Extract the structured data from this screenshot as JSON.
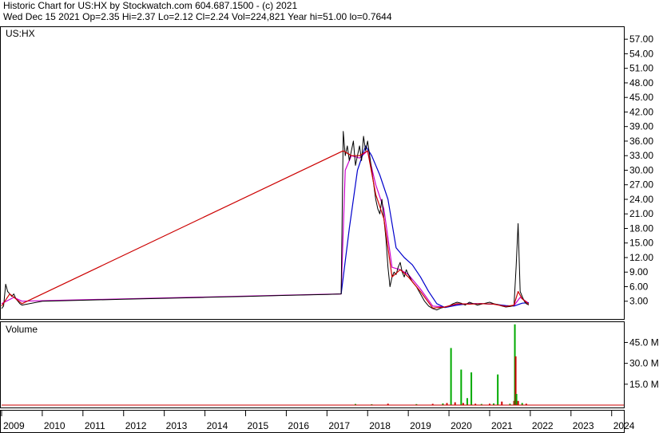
{
  "header": {
    "line1": "Historic Chart for US:HX by Stockwatch.com 604.687.1500 - (c) 2021",
    "line2": "Wed Dec 15 2021  Op=2.35  Hi=2.37  Lo=2.12  Cl=2.24  Vol=224,821  Year hi=51.00  lo=0.7644"
  },
  "colors": {
    "price": "#000000",
    "short_ma": "#cc0000",
    "mid_ma": "#cc00cc",
    "long_ma": "#0000cc",
    "volume_up": "#00aa00",
    "volume_down": "#cc0000"
  },
  "chart_data": [
    {
      "type": "line",
      "title": "US:HX",
      "xlabel": "",
      "ylabel": "",
      "x_tick_labels": [
        "2009",
        "2010",
        "2011",
        "2012",
        "2013",
        "2014",
        "2015",
        "2016",
        "2017",
        "2018",
        "2019",
        "2020",
        "2021",
        "2022",
        "2023",
        "2024"
      ],
      "y_tick_labels": [
        "3.00",
        "6.00",
        "9.00",
        "12.00",
        "15.00",
        "18.00",
        "21.00",
        "24.00",
        "27.00",
        "30.00",
        "33.00",
        "36.00",
        "39.00",
        "42.00",
        "45.00",
        "48.00",
        "51.00",
        "54.00",
        "57.00"
      ],
      "y_ticks": [
        3,
        6,
        9,
        12,
        15,
        18,
        21,
        24,
        27,
        30,
        33,
        36,
        39,
        42,
        45,
        48,
        51,
        54,
        57
      ],
      "ylim": [
        0,
        59
      ],
      "xlim": [
        2009.0,
        2024.3
      ],
      "grid": false,
      "series": [
        {
          "role": "price",
          "x": [
            2009.0,
            2009.05,
            2009.1,
            2009.15,
            2009.2,
            2009.25,
            2009.3,
            2009.35,
            2009.4,
            2009.45,
            2009.5,
            2010.0,
            2011.0,
            2012.0,
            2013.0,
            2014.0,
            2015.0,
            2016.0,
            2017.0,
            2017.35,
            2017.4,
            2017.45,
            2017.5,
            2017.55,
            2017.6,
            2017.65,
            2017.7,
            2017.75,
            2017.8,
            2017.85,
            2017.9,
            2017.95,
            2018.0,
            2018.05,
            2018.1,
            2018.15,
            2018.2,
            2018.25,
            2018.3,
            2018.35,
            2018.4,
            2018.45,
            2018.5,
            2018.55,
            2018.6,
            2018.65,
            2018.7,
            2018.75,
            2018.8,
            2018.85,
            2018.9,
            2018.95,
            2019.0,
            2019.1,
            2019.2,
            2019.3,
            2019.4,
            2019.5,
            2019.6,
            2019.7,
            2019.8,
            2019.9,
            2020.0,
            2020.1,
            2020.2,
            2020.3,
            2020.4,
            2020.5,
            2020.6,
            2020.7,
            2020.8,
            2020.9,
            2021.0,
            2021.1,
            2021.2,
            2021.3,
            2021.4,
            2021.5,
            2021.55,
            2021.6,
            2021.65,
            2021.7,
            2021.75,
            2021.8,
            2021.85,
            2021.9,
            2021.96
          ],
          "values": [
            1.5,
            2.0,
            6.5,
            5.0,
            4.5,
            4.0,
            4.5,
            3.5,
            3.0,
            2.5,
            2.2,
            3.0,
            3.2,
            3.4,
            3.6,
            3.8,
            4.0,
            4.2,
            4.4,
            4.5,
            38.0,
            33.0,
            35.0,
            32.0,
            34.0,
            36.0,
            31.0,
            33.0,
            35.0,
            32.0,
            37.0,
            34.0,
            36.0,
            33.0,
            30.0,
            27.0,
            24.0,
            22.0,
            21.0,
            24.0,
            20.0,
            16.0,
            10.0,
            6.0,
            8.0,
            9.0,
            8.5,
            10.0,
            11.0,
            9.0,
            8.0,
            9.5,
            8.5,
            7.0,
            6.0,
            4.5,
            3.0,
            2.0,
            1.5,
            1.2,
            1.6,
            1.8,
            2.0,
            2.5,
            2.8,
            2.6,
            2.2,
            2.8,
            2.5,
            2.2,
            2.4,
            2.6,
            2.8,
            2.5,
            2.3,
            2.0,
            1.8,
            1.9,
            2.0,
            2.2,
            10.0,
            19.0,
            5.0,
            4.0,
            3.0,
            2.5,
            2.24
          ]
        },
        {
          "role": "short_ma",
          "x": [
            2009.0,
            2009.2,
            2009.5,
            2017.4,
            2017.6,
            2017.8,
            2018.0,
            2018.2,
            2018.4,
            2018.6,
            2018.8,
            2019.0,
            2019.3,
            2019.6,
            2019.9,
            2020.2,
            2020.5,
            2020.8,
            2021.1,
            2021.4,
            2021.6,
            2021.7,
            2021.8,
            2021.96
          ],
          "values": [
            2.0,
            4.5,
            2.5,
            34.0,
            33.0,
            33.0,
            34.0,
            25.0,
            20.0,
            8.0,
            9.5,
            8.0,
            5.0,
            1.6,
            1.8,
            2.5,
            2.4,
            2.5,
            2.4,
            1.9,
            2.2,
            5.0,
            3.5,
            2.4
          ]
        },
        {
          "role": "mid_ma",
          "x": [
            2009.0,
            2009.3,
            2009.5,
            2017.35,
            2017.45,
            2017.6,
            2017.8,
            2018.0,
            2018.2,
            2018.4,
            2018.6,
            2018.8,
            2019.0,
            2019.3,
            2019.6,
            2019.9,
            2020.2,
            2020.5,
            2020.8,
            2021.1,
            2021.4,
            2021.6,
            2021.75,
            2021.96
          ],
          "values": [
            2.5,
            3.8,
            3.0,
            4.5,
            30.0,
            33.0,
            32.5,
            34.0,
            27.0,
            22.0,
            10.0,
            9.5,
            8.5,
            5.5,
            2.0,
            1.8,
            2.4,
            2.5,
            2.5,
            2.4,
            2.0,
            2.1,
            3.8,
            2.6
          ]
        },
        {
          "role": "long_ma",
          "x": [
            2017.35,
            2017.55,
            2017.75,
            2017.95,
            2018.1,
            2018.3,
            2018.5,
            2018.7,
            2018.9,
            2019.1,
            2019.3,
            2019.5,
            2019.7,
            2019.9,
            2020.2,
            2020.5,
            2020.8,
            2021.1,
            2021.4,
            2021.6,
            2021.8,
            2021.96
          ],
          "values": [
            4.5,
            18.0,
            30.0,
            35.0,
            33.0,
            29.0,
            24.0,
            14.0,
            12.0,
            10.5,
            8.0,
            5.0,
            2.5,
            1.7,
            2.2,
            2.5,
            2.5,
            2.4,
            2.1,
            2.0,
            2.6,
            2.7
          ]
        }
      ]
    },
    {
      "type": "bar",
      "title": "Volume",
      "xlabel": "",
      "ylabel": "",
      "y_tick_labels": [
        "15.0 M",
        "30.0 M",
        "45.0 M"
      ],
      "y_ticks": [
        15,
        30,
        45
      ],
      "ylim": [
        0,
        59
      ],
      "grid": false,
      "series": [
        {
          "name": "",
          "role": "volume",
          "x": [
            2017.7,
            2018.1,
            2018.5,
            2019.2,
            2019.6,
            2019.85,
            2019.95,
            2020.05,
            2020.15,
            2020.3,
            2020.35,
            2020.45,
            2020.55,
            2020.65,
            2020.8,
            2021.0,
            2021.1,
            2021.2,
            2021.3,
            2021.5,
            2021.6,
            2021.62,
            2021.64,
            2021.66,
            2021.7,
            2021.8,
            2021.9
          ],
          "values": [
            0.8,
            0.6,
            1.0,
            0.7,
            0.9,
            1.2,
            1.5,
            41.0,
            2.0,
            25.5,
            1.5,
            5.0,
            23.5,
            1.0,
            0.8,
            1.0,
            1.2,
            22.0,
            2.5,
            1.0,
            3.0,
            58.0,
            35.0,
            8.0,
            3.0,
            1.5,
            1.0
          ],
          "up": [
            true,
            true,
            false,
            true,
            false,
            true,
            false,
            true,
            false,
            true,
            false,
            true,
            true,
            false,
            true,
            false,
            true,
            true,
            false,
            true,
            false,
            true,
            false,
            true,
            false,
            true,
            false
          ]
        }
      ]
    }
  ]
}
